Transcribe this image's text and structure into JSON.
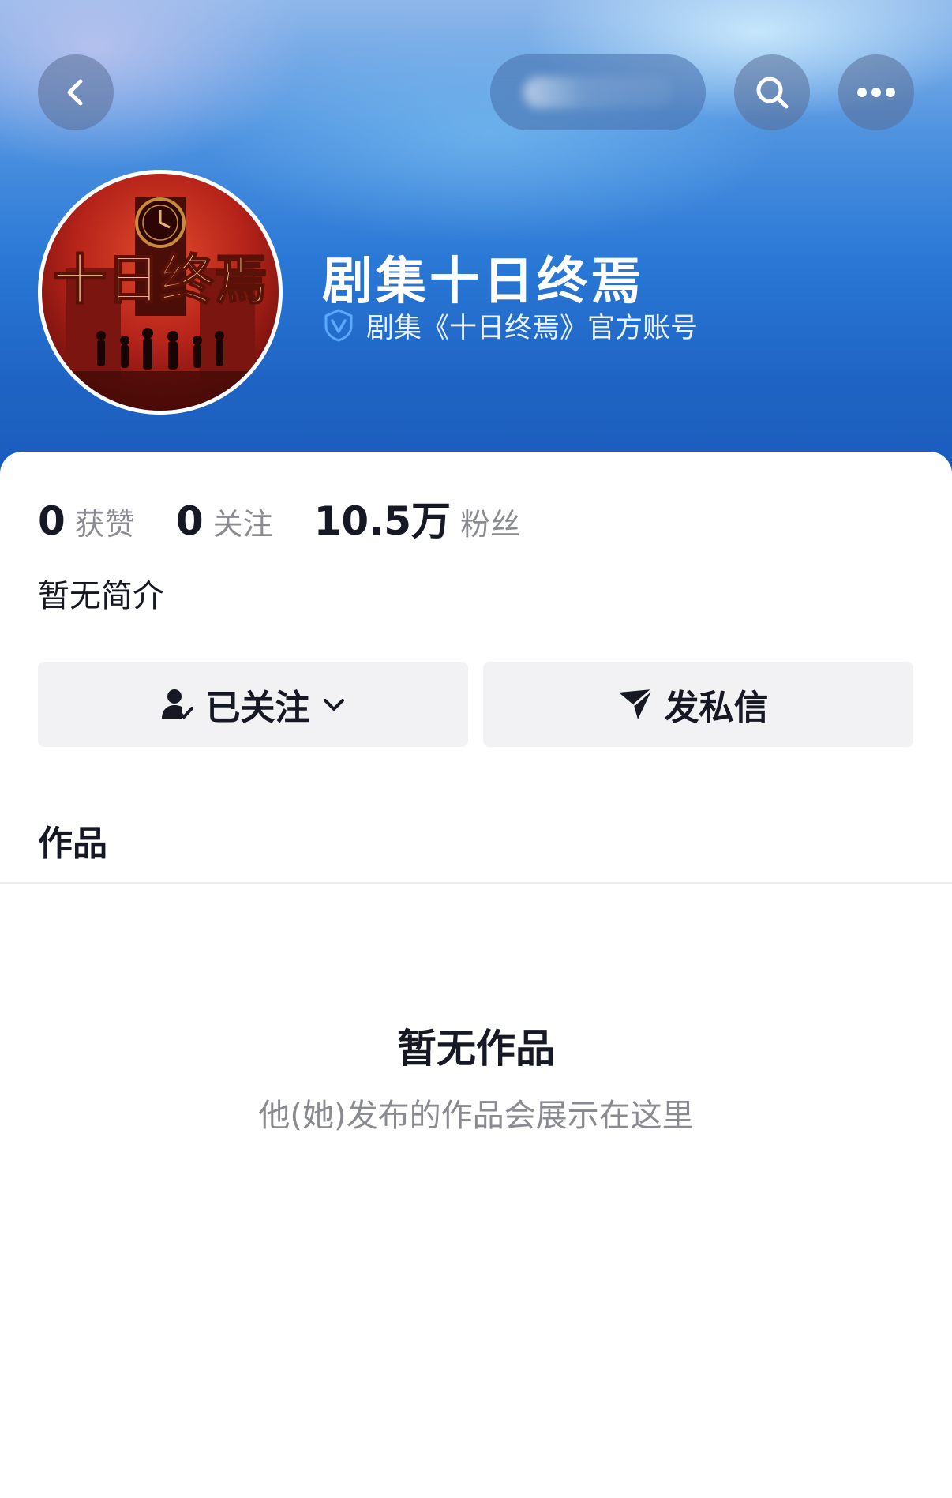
{
  "header": {
    "profile_name": "剧集十日终焉",
    "verified_description": "剧集《十日终焉》官方账号",
    "avatar_title": "十日终焉",
    "icons": {
      "back": "chevron-left-icon",
      "search": "search-icon",
      "more": "more-horizontal-icon",
      "verified": "verified-v-icon"
    }
  },
  "stats": {
    "likes_value": "0",
    "likes_label": "获赞",
    "following_value": "0",
    "following_label": "关注",
    "followers_value": "10.5万",
    "followers_label": "粉丝"
  },
  "bio": "暂无简介",
  "actions": {
    "follow_label": "已关注",
    "message_label": "发私信"
  },
  "tabs": {
    "works_label": "作品"
  },
  "empty_state": {
    "title": "暂无作品",
    "subtitle": "他(她)发布的作品会展示在这里"
  },
  "colors": {
    "header_blue": "#2a78d6",
    "text_primary": "#161823",
    "text_secondary": "#8a8b91",
    "button_bg": "#f2f2f4",
    "verified_blue": "#5aa9ff"
  }
}
